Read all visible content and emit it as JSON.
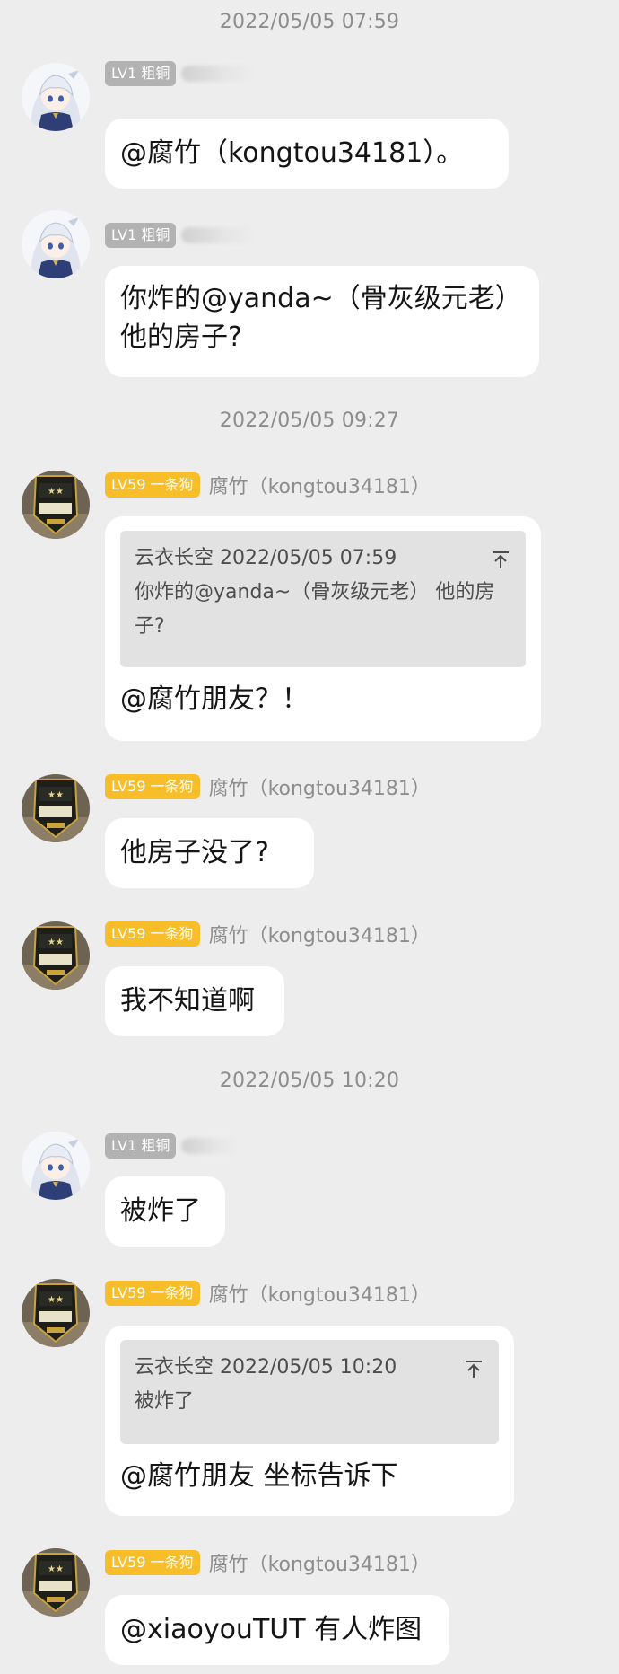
{
  "timestamps": [
    "2022/05/05 07:59",
    "2022/05/05 09:27",
    "2022/05/05 10:20"
  ],
  "badges": {
    "lv1": "LV1 粗铜",
    "lv59": "LV59 一条狗"
  },
  "user_b": {
    "name": "腐竹（kongtou34181）"
  },
  "messages": [
    {
      "text": "@腐竹（kongtou34181）。"
    },
    {
      "text": "你炸的@yanda~（骨灰级元老） 他的房子?"
    },
    {
      "quote_header": "云衣长空 2022/05/05 07:59",
      "quote_text": "你炸的@yanda~（骨灰级元老） 他的房子?",
      "text": "@腐竹朋友？！"
    },
    {
      "text": "他房子没了?"
    },
    {
      "text": "我不知道啊"
    },
    {
      "text": "被炸了"
    },
    {
      "quote_header": "云衣长空 2022/05/05 10:20",
      "quote_text": "被炸了",
      "text": "@腐竹朋友 坐标告诉下"
    },
    {
      "text": "@xiaoyouTUT 有人炸图"
    }
  ],
  "colors": {
    "background": "#ededed",
    "badge_gray": "#b2b2b2",
    "badge_gold": "#f7be29"
  },
  "icons": [
    "anime-girl-avatar",
    "game-badge-avatar",
    "arrow-up-to-top-icon"
  ]
}
